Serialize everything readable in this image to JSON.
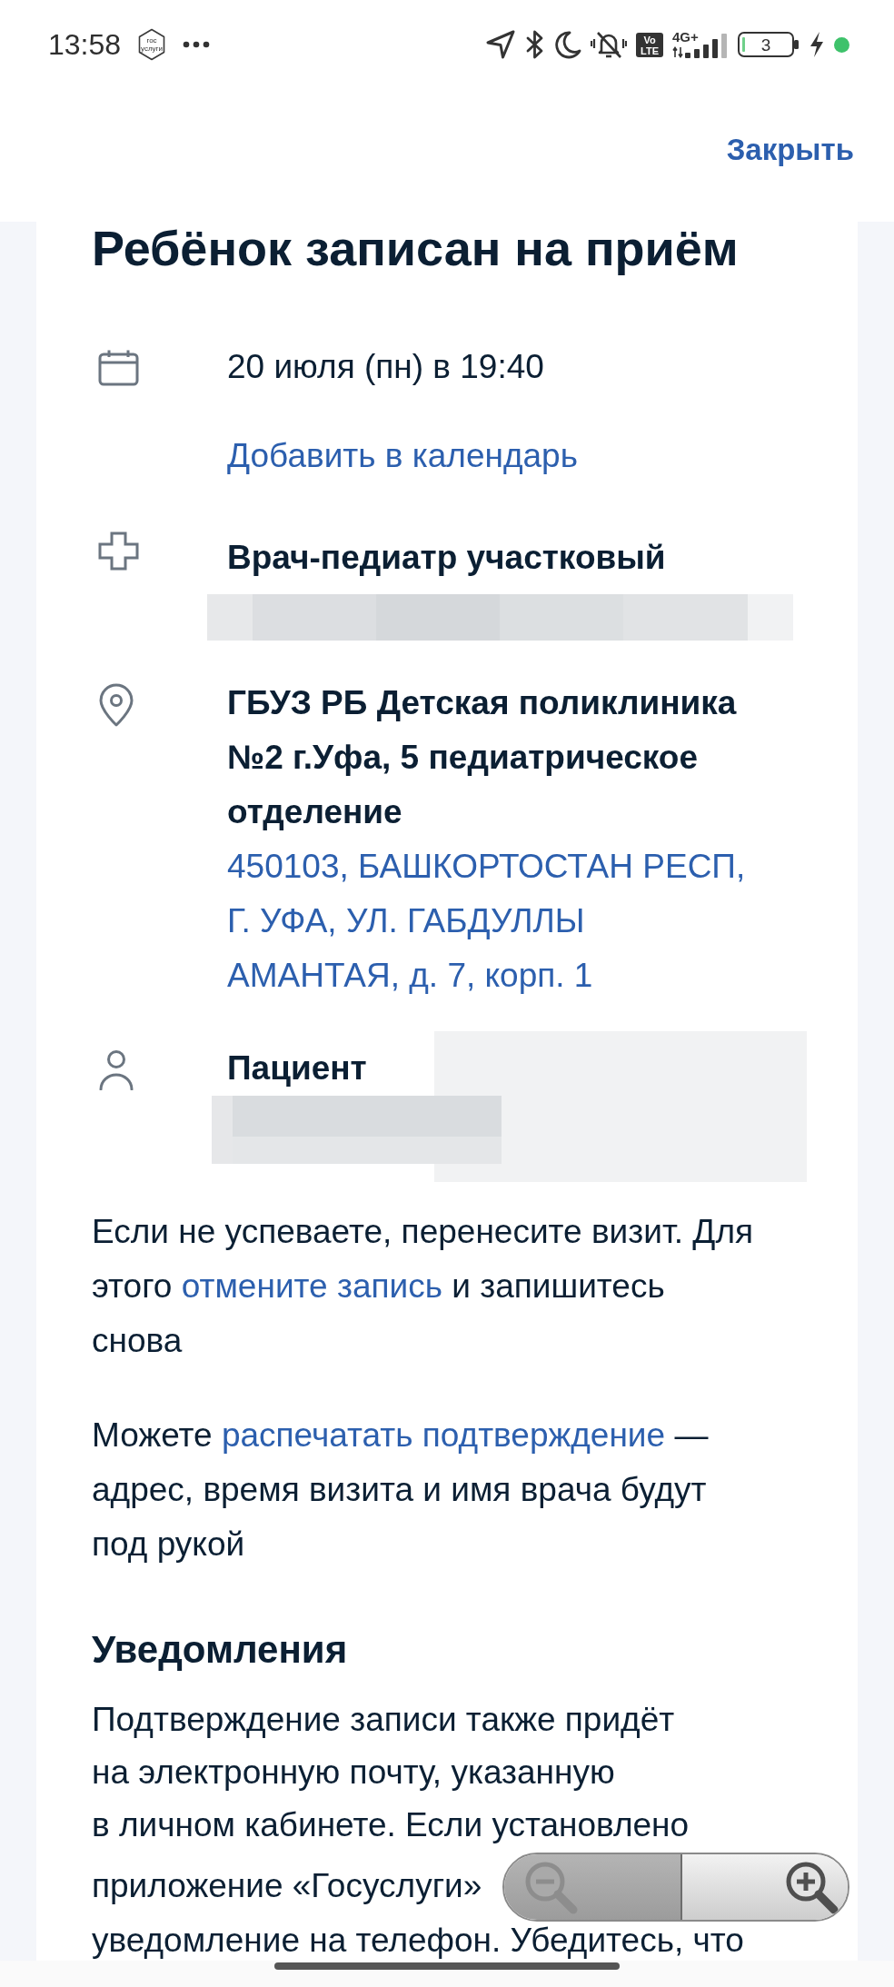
{
  "status_bar": {
    "time": "13:58",
    "app_logo": [
      "гос",
      "услуги"
    ],
    "volte": [
      "Vo",
      "LTE"
    ],
    "network": "4G+",
    "battery": "3"
  },
  "header": {
    "close_link": "Закрыть"
  },
  "title": "Ребёнок записан на приём",
  "details": [
    {
      "kind": "date",
      "text": "20 июля (пн) в 19:40",
      "link": "Добавить в календарь"
    },
    {
      "kind": "doctor",
      "text": "Врач-педиатр участковый"
    },
    {
      "kind": "clinic",
      "text": "ГБУЗ РБ Детская поликлиника №2 г.Уфа, 5 педиатрическое отделение",
      "link": "450103, БАШКОРТОСТАН РЕСП, Г. УФА, УЛ. ГАБДУЛЛЫ АМАНТАЯ, д. 7, корп. 1"
    },
    {
      "kind": "patient",
      "text": "Пациент"
    }
  ],
  "notes": [
    {
      "before": "Если не успеваете, перенесите визит. Для\nэтого ",
      "link": "отмените запись",
      "after": " и запишитесь\nснова"
    },
    {
      "before": "Можете ",
      "link": "распечатать подтверждение",
      "after": " —\nадрес, время визита и имя врача будут\nпод рукой"
    }
  ],
  "notifications": {
    "heading": "Уведомления",
    "text_parts": [
      "Подтверждение записи также придёт\nна электронную почту, указанную\nв личном кабинете. Если установлено",
      "приложение «Госуслуги»",
      "уведомление на телефон. Убедитесь, что"
    ]
  },
  "zoom_control": [
    {
      "kind": "zoom_out",
      "disabled": true
    },
    {
      "kind": "zoom_in",
      "disabled": false
    }
  ]
}
